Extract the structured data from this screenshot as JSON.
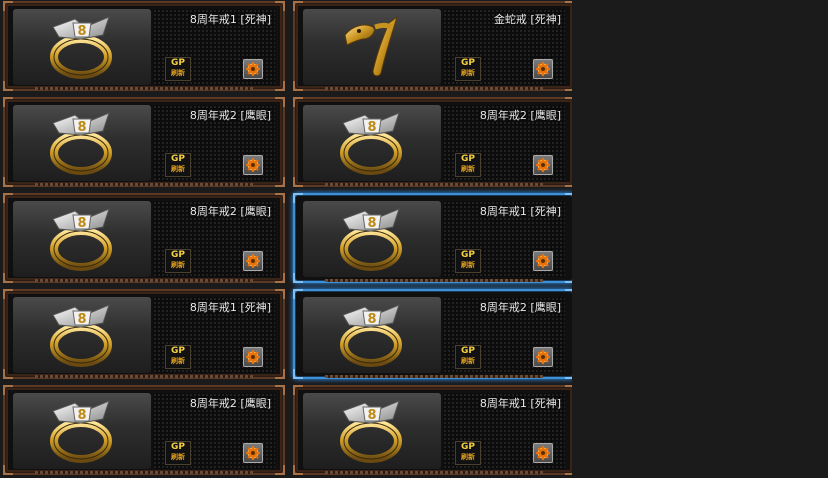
{
  "items": [
    {
      "name": "8周年戒1 [死神]",
      "icon": "ring-icon",
      "badge_top": "GP",
      "badge_bottom": "刷新",
      "selected": false
    },
    {
      "name": "金蛇戒 [死神]",
      "icon": "snake-ring-icon",
      "badge_top": "GP",
      "badge_bottom": "刷新",
      "selected": false
    },
    {
      "name": "8周年戒2 [鹰眼]",
      "icon": "ring-icon",
      "badge_top": "GP",
      "badge_bottom": "刷新",
      "selected": false
    },
    {
      "name": "8周年戒2 [鹰眼]",
      "icon": "ring-icon",
      "badge_top": "GP",
      "badge_bottom": "刷新",
      "selected": false
    },
    {
      "name": "8周年戒2 [鹰眼]",
      "icon": "ring-icon",
      "badge_top": "GP",
      "badge_bottom": "刷新",
      "selected": false
    },
    {
      "name": "8周年戒1 [死神]",
      "icon": "ring-icon",
      "badge_top": "GP",
      "badge_bottom": "刷新",
      "selected": true
    },
    {
      "name": "8周年戒1 [死神]",
      "icon": "ring-icon",
      "badge_top": "GP",
      "badge_bottom": "刷新",
      "selected": false
    },
    {
      "name": "8周年戒2 [鹰眼]",
      "icon": "ring-icon",
      "badge_top": "GP",
      "badge_bottom": "刷新",
      "selected": true
    },
    {
      "name": "8周年戒2 [鹰眼]",
      "icon": "ring-icon",
      "badge_top": "GP",
      "badge_bottom": "刷新",
      "selected": false
    },
    {
      "name": "8周年戒1 [死神]",
      "icon": "ring-icon",
      "badge_top": "GP",
      "badge_bottom": "刷新",
      "selected": false
    }
  ],
  "colors": {
    "background": "#1b1b1b",
    "frame_bronze": "#5a3a26",
    "selected_blue": "#3d8fd6",
    "gold": "#d4a22a"
  }
}
